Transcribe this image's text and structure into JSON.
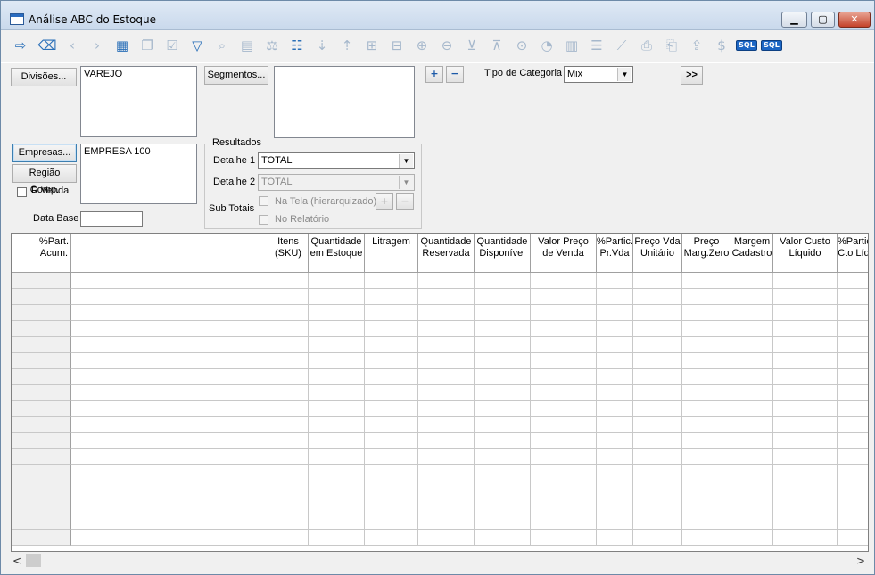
{
  "window": {
    "title": "Análise ABC do Estoque"
  },
  "toolbar": {
    "icons": [
      "exit-icon",
      "eraser-icon",
      "prev-icon",
      "next-icon",
      "grid-icon",
      "copy-icon",
      "check-icon",
      "filter-icon",
      "search-icon",
      "calc-icon",
      "scale-icon",
      "edit-list-icon",
      "sort-asc-icon",
      "sort-desc-icon",
      "group-icon",
      "ungroup-icon",
      "expand-icon",
      "collapse-icon",
      "filter-add-icon",
      "filter-remove-icon",
      "zoom-icon",
      "pie-chart-icon",
      "bar-chart-icon",
      "hbar-chart-icon",
      "line-chart-icon",
      "print-icon",
      "print-preview-icon",
      "export-icon",
      "currency-icon",
      "sql-icon",
      "sql2-icon"
    ],
    "sql_label": "SQL",
    "sql2_label": "SQL"
  },
  "filters": {
    "divisoes_label": "Divisões...",
    "divisoes_value": "VAREJO",
    "segmentos_label": "Segmentos...",
    "segmentos_value": "",
    "empresas_label": "Empresas...",
    "empresas_value": "EMPRESA 100",
    "regiao_label": "Região Comp.",
    "rvenda_label": "R.Venda",
    "data_base_label": "Data Base",
    "data_base_value": "",
    "plus_label": "+",
    "minus_label": "−",
    "tipo_categoria_label": "Tipo de Categoria",
    "tipo_categoria_value": "Mix",
    "more_label": ">>"
  },
  "resultados": {
    "title": "Resultados",
    "detalhe1_label": "Detalhe 1",
    "detalhe1_value": "TOTAL",
    "detalhe2_label": "Detalhe 2",
    "detalhe2_value": "TOTAL",
    "subtotais_label": "Sub Totais",
    "na_tela_label": "Na Tela (hierarquizado)",
    "no_relatorio_label": "No Relatório"
  },
  "grid": {
    "columns": [
      {
        "label": ""
      },
      {
        "label": "%Part.\nAcum."
      },
      {
        "label": ""
      },
      {
        "label": "Itens\n(SKU)"
      },
      {
        "label": "Quantidade\nem Estoque"
      },
      {
        "label": "Litragem"
      },
      {
        "label": "Quantidade\nReservada"
      },
      {
        "label": "Quantidade\nDisponível"
      },
      {
        "label": "Valor Preço\nde Venda"
      },
      {
        "label": "%Partic.\nPr.Vda"
      },
      {
        "label": "Preço Vda\nUnitário"
      },
      {
        "label": "Preço\nMarg.Zero"
      },
      {
        "label": "Margem\nCadastro"
      },
      {
        "label": "Valor Custo\nLíquido"
      },
      {
        "label": "%Partic.\nCto Líq."
      }
    ]
  },
  "scrollbar": {
    "left_arrow": "<",
    "right_arrow": ">"
  }
}
